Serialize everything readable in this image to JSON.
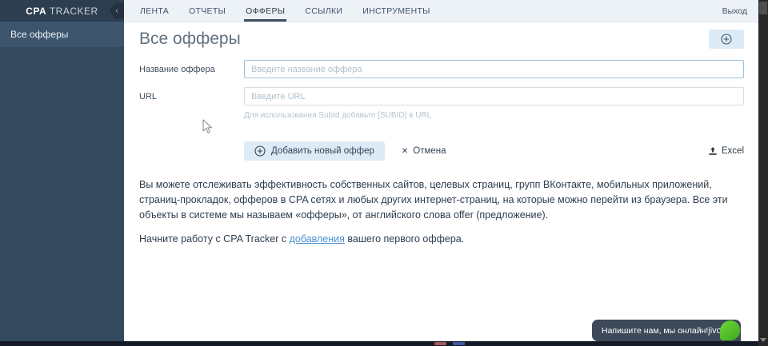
{
  "sidebar": {
    "logo_bold": "CPA",
    "logo_rest": " TRACKER",
    "collapse_icon": "‹",
    "items": [
      {
        "label": "Все офферы",
        "active": true
      }
    ]
  },
  "topnav": {
    "tabs": [
      {
        "label": "ЛЕНТА",
        "active": false
      },
      {
        "label": "ОТЧЕТЫ",
        "active": false
      },
      {
        "label": "ОФФЕРЫ",
        "active": true
      },
      {
        "label": "ССЫЛКИ",
        "active": false
      },
      {
        "label": "ИНСТРУМЕНТЫ",
        "active": false
      }
    ],
    "logout_label": "Выход"
  },
  "main": {
    "title": "Все офферы",
    "form": {
      "name_label": "Название оффера",
      "name_value": "",
      "name_placeholder": "Введите название оффера",
      "url_label": "URL",
      "url_value": "",
      "url_placeholder": "Введите URL",
      "url_hint": "Для использования SubId добавьте [SUBID] в URL",
      "submit_label": "Добавить новый оффер",
      "cancel_label": "Отмена",
      "cancel_icon": "✕",
      "excel_label": "Excel"
    },
    "description": "Вы можете отслеживать эффективность собственных сайтов, целевых страниц, групп ВКонтакте, мобильных приложений, страниц-прокладок, офферов в CPA сетях и любых других интернет-страниц, на которые можно перейти из браузера. Все эти объекты в системе мы называем «офферы», от английского слова offer (предложение).",
    "cta_before": "Начните работу с CPA Tracker с ",
    "cta_link": "добавления",
    "cta_after": " вашего первого оффера."
  },
  "chat": {
    "message": "Напишите нам, мы онлайн!",
    "brand": "jivo"
  },
  "colors": {
    "sidebar_bg": "#34495e",
    "sidebar_header_bg": "#2d3e50",
    "sidebar_active_bg": "#3d566e",
    "nav_bg": "#edf2f7",
    "accent_button_bg": "#dcebf6",
    "focused_input_border": "#9cc0da",
    "link_color": "#4a90d2",
    "chat_bg": "#3d4959",
    "jivo_green": "#4cbb2f"
  }
}
